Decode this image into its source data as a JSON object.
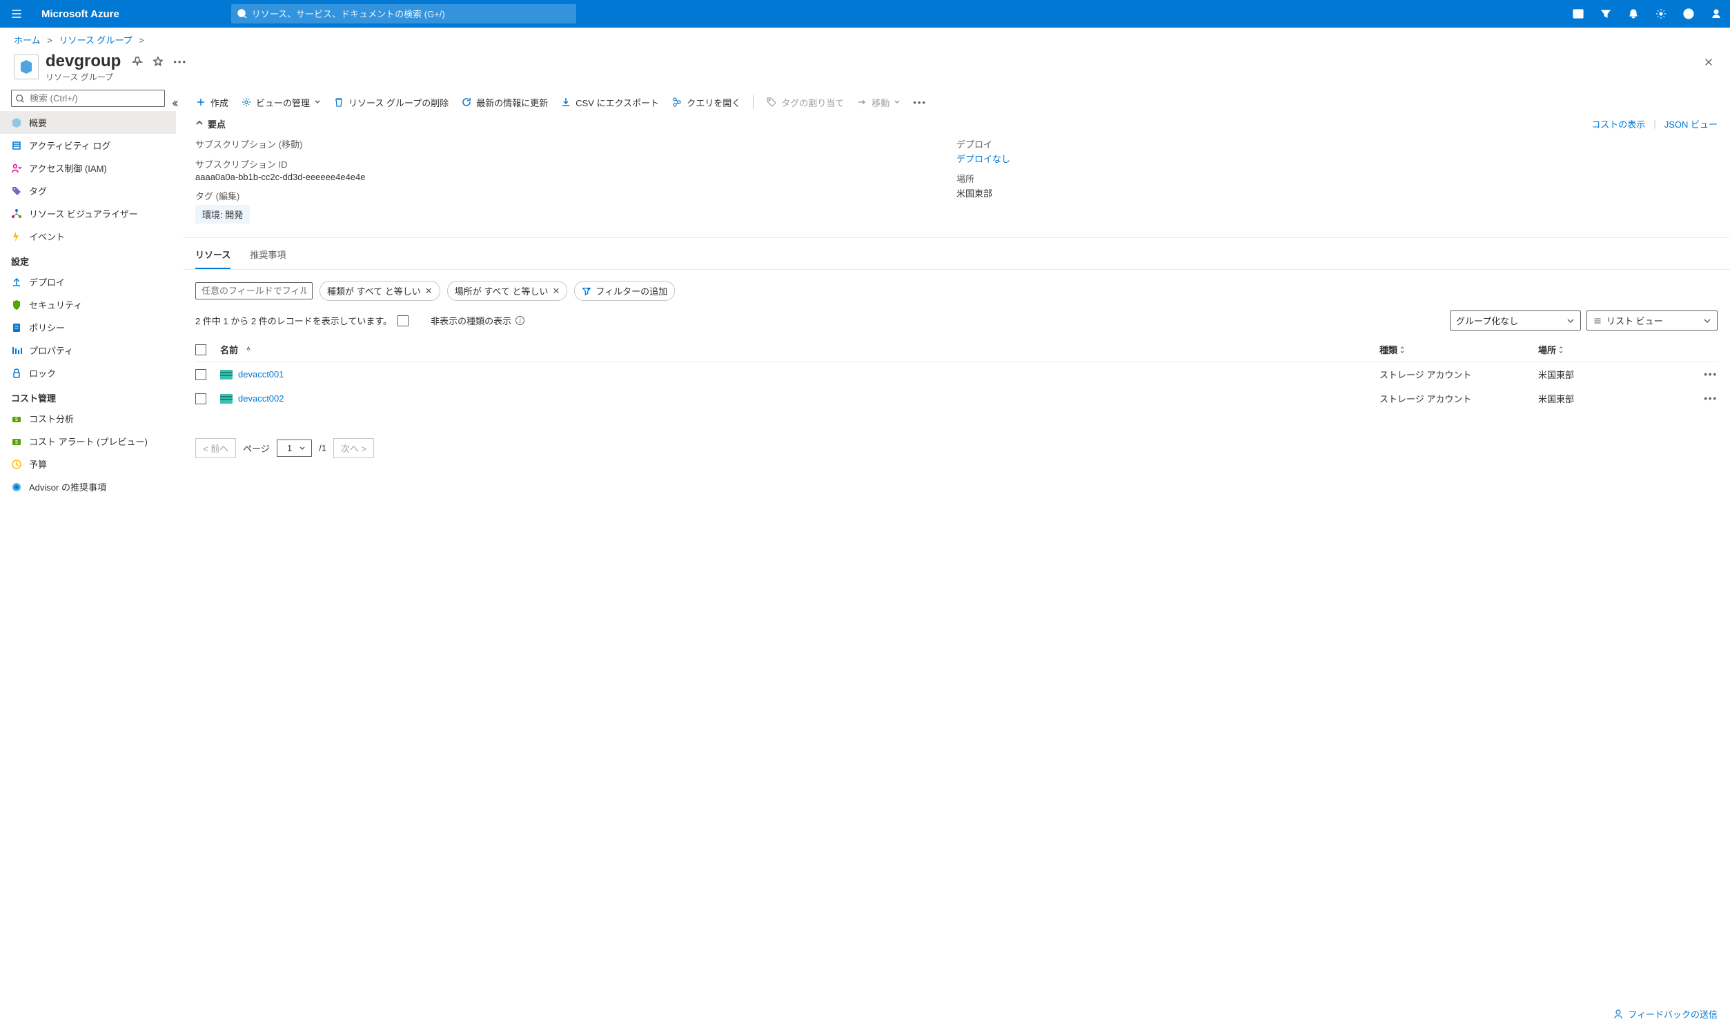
{
  "topbar": {
    "brand": "Microsoft Azure",
    "search_placeholder": "リソース、サービス、ドキュメントの検索 (G+/)"
  },
  "breadcrumb": {
    "home": "ホーム",
    "rg": "リソース グループ"
  },
  "header": {
    "title": "devgroup",
    "subtitle": "リソース グループ"
  },
  "sidebar": {
    "search_placeholder": "検索 (Ctrl+/)",
    "items_top": [
      {
        "label": "概要"
      },
      {
        "label": "アクティビティ ログ"
      },
      {
        "label": "アクセス制御 (IAM)"
      },
      {
        "label": "タグ"
      },
      {
        "label": "リソース ビジュアライザー"
      },
      {
        "label": "イベント"
      }
    ],
    "section_settings": "設定",
    "items_settings": [
      {
        "label": "デプロイ"
      },
      {
        "label": "セキュリティ"
      },
      {
        "label": "ポリシー"
      },
      {
        "label": "プロパティ"
      },
      {
        "label": "ロック"
      }
    ],
    "section_cost": "コスト管理",
    "items_cost": [
      {
        "label": "コスト分析"
      },
      {
        "label": "コスト アラート (プレビュー)"
      },
      {
        "label": "予算"
      },
      {
        "label": "Advisor の推奨事項"
      }
    ]
  },
  "toolbar": {
    "create": "作成",
    "manage_view": "ビューの管理",
    "delete_rg": "リソース グループの削除",
    "refresh": "最新の情報に更新",
    "export_csv": "CSV にエクスポート",
    "open_query": "クエリを開く",
    "assign_tags": "タグの割り当て",
    "move": "移動"
  },
  "essentials": {
    "title": "要点",
    "view_cost": "コストの表示",
    "json_view": "JSON ビュー",
    "subscription_label": "サブスクリプション",
    "subscription_move": "移動",
    "subscription_id_label": "サブスクリプション ID",
    "subscription_id_value": "aaaa0a0a-bb1b-cc2c-dd3d-eeeeee4e4e4e",
    "tags_label": "タグ",
    "tags_edit": "編集",
    "tag_pill": "環境: 開発",
    "deploy_label": "デプロイ",
    "deploy_value": "デプロイなし",
    "location_label": "場所",
    "location_value": "米国東部"
  },
  "tabs": {
    "resources": "リソース",
    "recommendations": "推奨事項"
  },
  "filters": {
    "filter_placeholder": "任意のフィールドでフィルター...",
    "type_pill": "種類が すべて と等しい",
    "location_pill": "場所が すべて と等しい",
    "add_filter": "フィルターの追加"
  },
  "records": {
    "summary": "2 件中 1 から 2 件のレコードを表示しています。",
    "hidden_types": "非表示の種類の表示",
    "group_by_none": "グループ化なし",
    "list_view": "リスト ビュー"
  },
  "table": {
    "col_name": "名前",
    "col_type": "種類",
    "col_location": "場所",
    "rows": [
      {
        "name": "devacct001",
        "type": "ストレージ アカウント",
        "location": "米国東部"
      },
      {
        "name": "devacct002",
        "type": "ストレージ アカウント",
        "location": "米国東部"
      }
    ]
  },
  "pager": {
    "prev": "< 前へ",
    "page_label": "ページ",
    "page_value": "1",
    "page_total": "/1",
    "next": "次へ >"
  },
  "feedback": "フィードバックの送信"
}
